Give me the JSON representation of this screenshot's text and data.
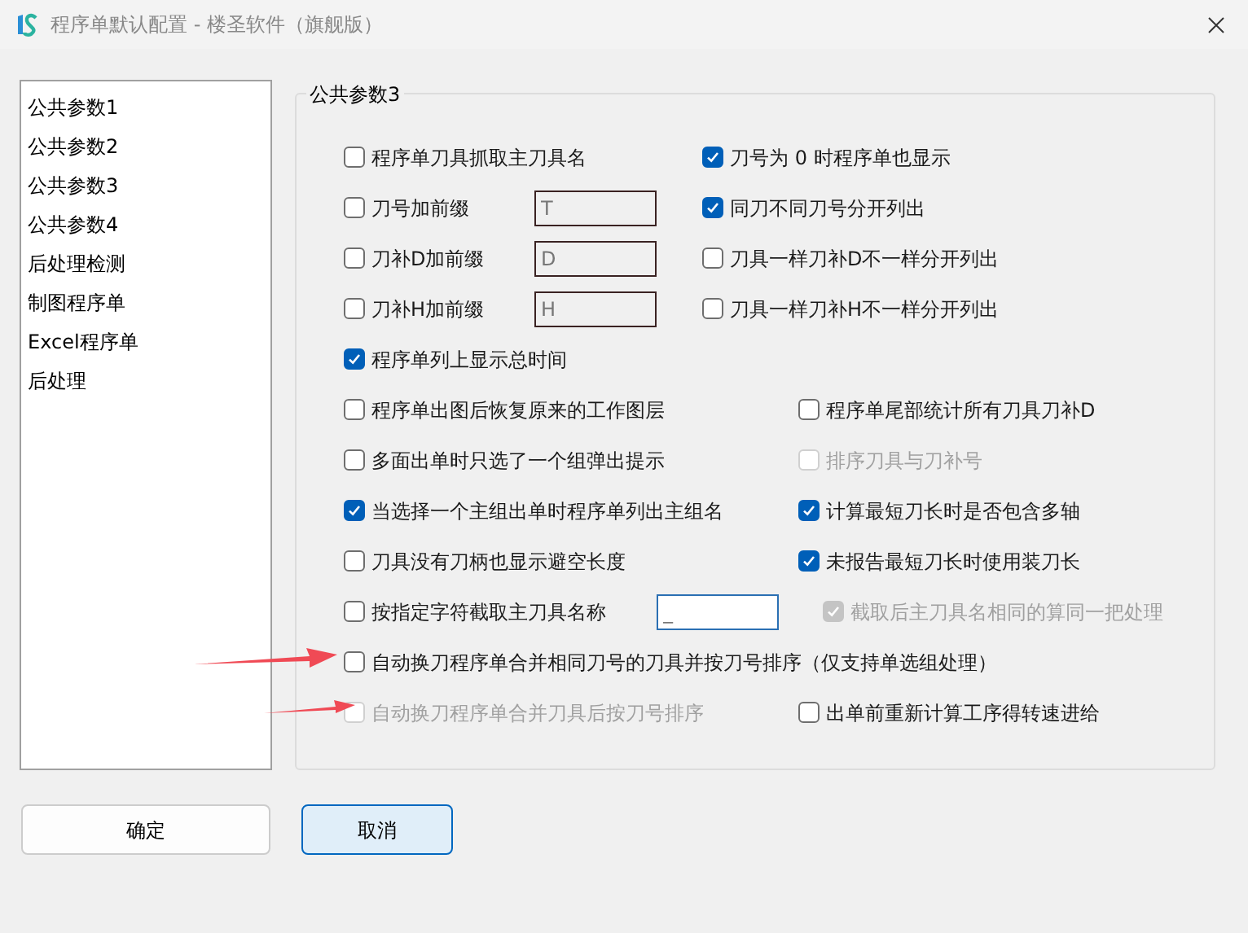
{
  "window": {
    "title": "程序单默认配置 - 楼圣软件（旗舰版）"
  },
  "sidebar": {
    "items": [
      {
        "label": "公共参数1",
        "selected": false
      },
      {
        "label": "公共参数2",
        "selected": false
      },
      {
        "label": "公共参数3",
        "selected": false
      },
      {
        "label": "公共参数4",
        "selected": false
      },
      {
        "label": "后处理检测",
        "selected": false
      },
      {
        "label": "制图程序单",
        "selected": false
      },
      {
        "label": "Excel程序单",
        "selected": false
      },
      {
        "label": "后处理",
        "selected": false
      }
    ]
  },
  "group": {
    "title": "公共参数3",
    "sections": [
      {
        "rows": [
          {
            "left": {
              "label": "程序单刀具抓取主刀具名",
              "checked": false,
              "disabled": false
            },
            "right": {
              "label": "刀号为 0 时程序单也显示",
              "checked": true,
              "disabled": false
            }
          },
          {
            "left": {
              "label": "刀号加前缀",
              "checked": false,
              "disabled": false
            },
            "field": {
              "value": "T",
              "focused": false
            },
            "right": {
              "label": "同刀不同刀号分开列出",
              "checked": true,
              "disabled": false
            }
          },
          {
            "left": {
              "label": "刀补D加前缀",
              "checked": false,
              "disabled": false
            },
            "field": {
              "value": "D",
              "focused": false
            },
            "right": {
              "label": "刀具一样刀补D不一样分开列出",
              "checked": false,
              "disabled": false
            }
          },
          {
            "left": {
              "label": "刀补H加前缀",
              "checked": false,
              "disabled": false
            },
            "field": {
              "value": "H",
              "focused": false
            },
            "right": {
              "label": "刀具一样刀补H不一样分开列出",
              "checked": false,
              "disabled": false
            }
          },
          {
            "left": {
              "label": "程序单列上显示总时间",
              "checked": true,
              "disabled": false
            }
          }
        ]
      },
      {
        "rows": [
          {
            "left": {
              "label": "程序单出图后恢复原来的工作图层",
              "checked": false,
              "disabled": false
            },
            "right": {
              "label": "程序单尾部统计所有刀具刀补D",
              "checked": false,
              "disabled": false
            }
          },
          {
            "left": {
              "label": "多面出单时只选了一个组弹出提示",
              "checked": false,
              "disabled": false
            },
            "right": {
              "label": "排序刀具与刀补号",
              "checked": false,
              "disabled": true
            }
          },
          {
            "left": {
              "label": "当选择一个主组出单时程序单列出主组名",
              "checked": true,
              "disabled": false
            },
            "right": {
              "label": "计算最短刀长时是否包含多轴",
              "checked": true,
              "disabled": false
            }
          },
          {
            "left": {
              "label": "刀具没有刀柄也显示避空长度",
              "checked": false,
              "disabled": false
            },
            "right": {
              "label": "未报告最短刀长时使用装刀长",
              "checked": true,
              "disabled": false
            }
          },
          {
            "left": {
              "label": "按指定字符截取主刀具名称",
              "checked": false,
              "disabled": false
            },
            "field": {
              "value": "_",
              "focused": true
            },
            "right": {
              "label": "截取后主刀具名相同的算同一把处理",
              "checked": true,
              "disabled": true
            }
          },
          {
            "left": {
              "label": "自动换刀程序单合并相同刀号的刀具并按刀号排序（仅支持单选组处理）",
              "checked": false,
              "disabled": false
            }
          },
          {
            "left": {
              "label": "自动换刀程序单合并刀具后按刀号排序",
              "checked": false,
              "disabled": true
            },
            "right": {
              "label": "出单前重新计算工序得转速进给",
              "checked": false,
              "disabled": false
            }
          }
        ]
      }
    ]
  },
  "buttons": [
    {
      "label": "确定",
      "default": false
    },
    {
      "label": "取消",
      "default": true
    }
  ]
}
